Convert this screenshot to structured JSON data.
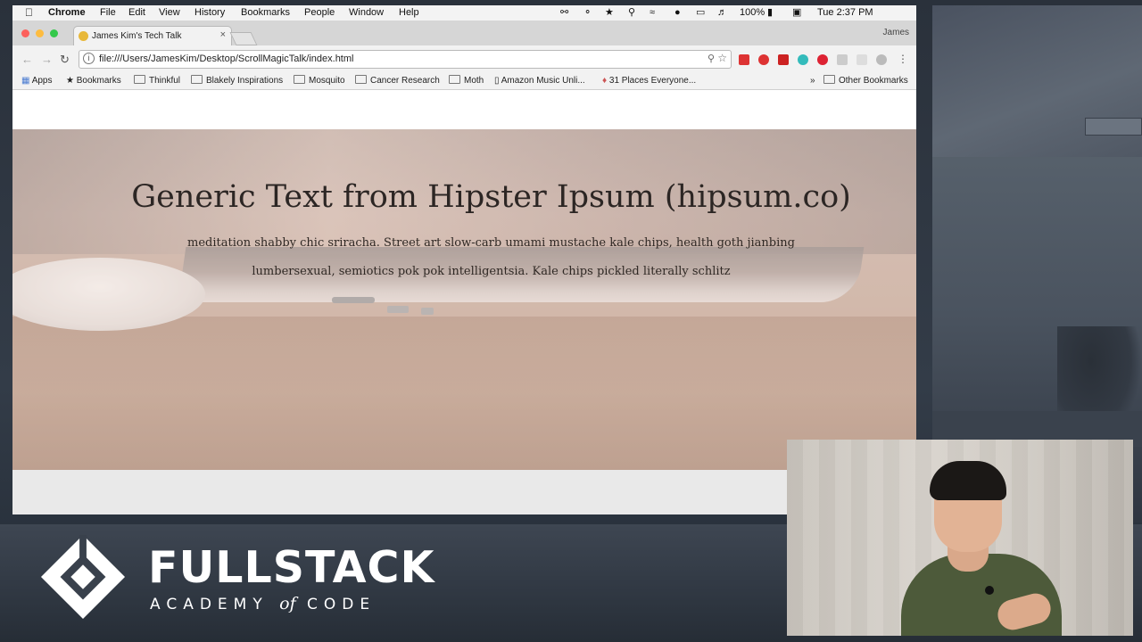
{
  "menubar": {
    "app": "Chrome",
    "items": [
      "File",
      "Edit",
      "View",
      "History",
      "Bookmarks",
      "People",
      "Window",
      "Help"
    ],
    "battery": "100%",
    "clock": "Tue 2:37 PM"
  },
  "tab": {
    "title": "James Kim's Tech Talk",
    "close": "×"
  },
  "profile": "James",
  "toolbar": {
    "url": "file:///Users/JamesKim/Desktop/ScrollMagicTalk/index.html"
  },
  "bookmarks": {
    "items": [
      "Apps",
      "Bookmarks",
      "Thinkful",
      "Blakely Inspirations",
      "Mosquito",
      "Cancer Research",
      "Moth",
      "Amazon Music Unli...",
      "31 Places Everyone..."
    ],
    "overflow": "»",
    "other": "Other Bookmarks"
  },
  "hero": {
    "title": "Generic Text from Hipster Ipsum (hipsum.co)",
    "body": "meditation shabby chic sriracha. Street art slow-carb umami mustache kale chips, health goth jianbing lumbersexual, semiotics pok pok intelligentsia. Kale chips pickled literally schlitz"
  },
  "branding": {
    "word": "FULLSTACK",
    "sub_left": "ACADEMY",
    "sub_of": "of",
    "sub_right": "CODE"
  },
  "colors": {
    "accent_tab": "#f2f2f2",
    "hero_bg": "#c7ab9a",
    "brand_white": "#ffffff"
  }
}
